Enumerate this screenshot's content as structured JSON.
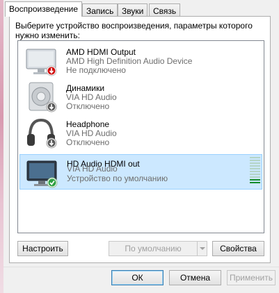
{
  "tabs": [
    {
      "label": "Воспроизведение",
      "active": true
    },
    {
      "label": "Запись",
      "active": false
    },
    {
      "label": "Звуки",
      "active": false
    },
    {
      "label": "Связь",
      "active": false
    }
  ],
  "description": "Выберите устройство воспроизведения, параметры которого нужно изменить:",
  "devices": [
    {
      "name": "AMD HDMI Output",
      "line1": "AMD High Definition Audio Device",
      "line2": "Не подключено",
      "icon": "monitor-icon",
      "badge": "red-disconnected-icon",
      "selected": false
    },
    {
      "name": "Динамики",
      "line1": "VIA HD Audio",
      "line2": "Отключено",
      "icon": "speaker-icon",
      "badge": "disabled-arrow-icon",
      "selected": false
    },
    {
      "name": "Headphone",
      "line1": "VIA HD Audio",
      "line2": "Отключено",
      "icon": "headphones-icon",
      "badge": "disabled-arrow-icon",
      "selected": false
    },
    {
      "name": "HD Audio HDMI out",
      "line1": "VIA HD Audio",
      "line2": "Устройство по умолчанию",
      "icon": "monitor-icon",
      "badge": "green-check-icon",
      "selected": true,
      "level_bars_lit": 2,
      "level_bars_total": 10
    }
  ],
  "buttons": {
    "configure": "Настроить",
    "set_default": "По умолчанию",
    "properties": "Свойства",
    "ok": "ОК",
    "cancel": "Отмена",
    "apply": "Применить"
  },
  "colors": {
    "selection": "#cce8ff",
    "level_green": "#1fa23a",
    "disconnected_red": "#d01010"
  }
}
